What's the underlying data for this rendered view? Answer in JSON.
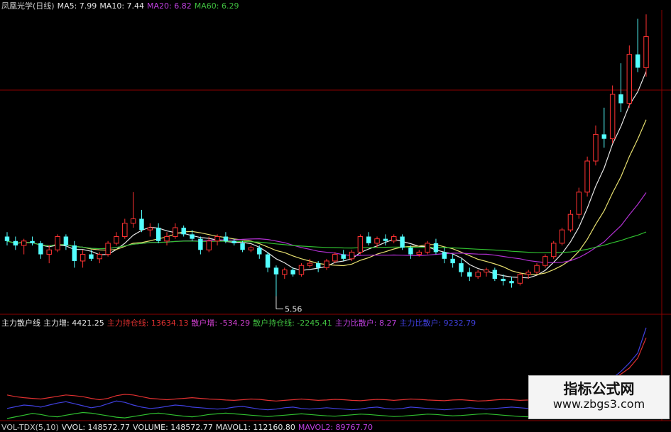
{
  "top_header": {
    "items": [
      {
        "text": "凤凰光学(日线)",
        "color": "#c8c8c8"
      },
      {
        "text": "MA5: 7.99",
        "color": "#e6e6e6"
      },
      {
        "text": "MA10: 7.44",
        "color": "#e6e6e6"
      },
      {
        "text": "MA20: 6.82",
        "color": "#c040e0"
      },
      {
        "text": "MA60: 6.29",
        "color": "#40c040"
      }
    ]
  },
  "indicator_header": {
    "items": [
      {
        "text": "主力散户线",
        "color": "#e6e6e6"
      },
      {
        "text": "主力增: 4421.25",
        "color": "#e6e6e6"
      },
      {
        "text": "主力持仓线: 13634.13",
        "color": "#e03030"
      },
      {
        "text": "散户增: -534.29",
        "color": "#d040d0"
      },
      {
        "text": "散户持仓线: -2245.41",
        "color": "#40c040"
      },
      {
        "text": "主力比散户: 8.27",
        "color": "#c040e0"
      },
      {
        "text": "主力比散户: 9232.79",
        "color": "#4040e0"
      }
    ]
  },
  "volume_header": {
    "items": [
      {
        "text": "VOL-TDX(5,10)",
        "color": "#c8c8c8"
      },
      {
        "text": "VVOL: 148572.77",
        "color": "#e6e6e6"
      },
      {
        "text": "VOLUME: 148572.77",
        "color": "#e6e6e6"
      },
      {
        "text": "MAVOL1: 112160.80",
        "color": "#e6e6e6"
      },
      {
        "text": "MAVOL2: 89767.70",
        "color": "#c040e0"
      }
    ]
  },
  "watermark": {
    "title": "指标公式网",
    "url": "www.zbgs3.com"
  },
  "colors": {
    "up": "#ff3232",
    "down": "#54ffff",
    "ma5": "#e6e6e6",
    "ma10": "#e8e070",
    "ma20": "#b030d0",
    "ma60": "#30c030",
    "grid": "#8b0000"
  },
  "chart_data": [
    {
      "type": "candlestick",
      "title": "凤凰光学(日线)",
      "price_range": [
        5.2,
        12.0
      ],
      "annotation": {
        "label": "5.56",
        "value": 5.56
      },
      "candles": [
        [
          6.9,
          7.0,
          6.7,
          6.8
        ],
        [
          6.8,
          6.9,
          6.6,
          6.7
        ],
        [
          6.7,
          6.85,
          6.5,
          6.8
        ],
        [
          6.8,
          6.9,
          6.7,
          6.75
        ],
        [
          6.75,
          6.8,
          6.4,
          6.5
        ],
        [
          6.5,
          6.7,
          6.3,
          6.6
        ],
        [
          6.6,
          6.95,
          6.55,
          6.9
        ],
        [
          6.9,
          6.95,
          6.6,
          6.7
        ],
        [
          6.7,
          6.8,
          6.2,
          6.35
        ],
        [
          6.35,
          6.6,
          6.2,
          6.5
        ],
        [
          6.5,
          6.6,
          6.35,
          6.4
        ],
        [
          6.4,
          6.55,
          6.3,
          6.5
        ],
        [
          6.5,
          6.8,
          6.45,
          6.75
        ],
        [
          6.75,
          7.0,
          6.7,
          6.9
        ],
        [
          6.9,
          7.3,
          6.85,
          7.2
        ],
        [
          7.2,
          7.9,
          7.1,
          7.3
        ],
        [
          7.3,
          7.5,
          7.0,
          7.05
        ],
        [
          7.05,
          7.2,
          6.9,
          7.1
        ],
        [
          7.1,
          7.2,
          6.75,
          6.8
        ],
        [
          6.8,
          7.0,
          6.7,
          6.9
        ],
        [
          6.9,
          7.2,
          6.85,
          7.1
        ],
        [
          7.1,
          7.15,
          6.9,
          6.95
        ],
        [
          6.95,
          7.05,
          6.8,
          6.85
        ],
        [
          6.85,
          6.9,
          6.5,
          6.6
        ],
        [
          6.6,
          6.9,
          6.55,
          6.8
        ],
        [
          6.8,
          6.95,
          6.7,
          6.9
        ],
        [
          6.9,
          7.0,
          6.75,
          6.8
        ],
        [
          6.8,
          6.85,
          6.7,
          6.75
        ],
        [
          6.75,
          6.8,
          6.55,
          6.6
        ],
        [
          6.6,
          6.7,
          6.55,
          6.65
        ],
        [
          6.65,
          6.7,
          6.4,
          6.5
        ],
        [
          6.5,
          6.55,
          6.1,
          6.2
        ],
        [
          6.2,
          6.25,
          5.56,
          6.05
        ],
        [
          6.05,
          6.2,
          5.95,
          6.15
        ],
        [
          6.15,
          6.2,
          6.0,
          6.05
        ],
        [
          6.05,
          6.3,
          6.0,
          6.25
        ],
        [
          6.25,
          6.4,
          6.2,
          6.3
        ],
        [
          6.3,
          6.35,
          6.1,
          6.2
        ],
        [
          6.2,
          6.4,
          6.15,
          6.35
        ],
        [
          6.35,
          6.55,
          6.3,
          6.5
        ],
        [
          6.5,
          6.6,
          6.35,
          6.4
        ],
        [
          6.4,
          6.6,
          6.35,
          6.55
        ],
        [
          6.55,
          6.95,
          6.5,
          6.9
        ],
        [
          6.9,
          7.0,
          6.7,
          6.75
        ],
        [
          6.75,
          6.9,
          6.65,
          6.85
        ],
        [
          6.85,
          6.95,
          6.7,
          6.8
        ],
        [
          6.8,
          6.95,
          6.75,
          6.9
        ],
        [
          6.9,
          6.95,
          6.6,
          6.65
        ],
        [
          6.65,
          6.7,
          6.4,
          6.5
        ],
        [
          6.5,
          6.6,
          6.45,
          6.55
        ],
        [
          6.55,
          6.8,
          6.5,
          6.75
        ],
        [
          6.75,
          6.85,
          6.5,
          6.55
        ],
        [
          6.55,
          6.65,
          6.3,
          6.4
        ],
        [
          6.4,
          6.5,
          6.2,
          6.3
        ],
        [
          6.3,
          6.4,
          6.0,
          6.1
        ],
        [
          6.1,
          6.2,
          5.9,
          6.0
        ],
        [
          6.0,
          6.15,
          5.95,
          6.1
        ],
        [
          6.1,
          6.2,
          6.0,
          6.15
        ],
        [
          6.15,
          6.2,
          5.9,
          5.95
        ],
        [
          5.95,
          6.05,
          5.8,
          5.9
        ],
        [
          5.9,
          6.0,
          5.75,
          5.85
        ],
        [
          5.85,
          6.1,
          5.8,
          6.05
        ],
        [
          6.05,
          6.15,
          5.95,
          6.1
        ],
        [
          6.1,
          6.3,
          6.05,
          6.25
        ],
        [
          6.25,
          6.5,
          6.2,
          6.45
        ],
        [
          6.45,
          6.8,
          6.4,
          6.75
        ],
        [
          6.75,
          7.1,
          6.7,
          7.05
        ],
        [
          7.05,
          7.5,
          7.0,
          7.4
        ],
        [
          7.4,
          8.0,
          7.3,
          7.9
        ],
        [
          7.9,
          8.7,
          7.8,
          8.6
        ],
        [
          8.6,
          9.4,
          8.5,
          9.2
        ],
        [
          9.2,
          9.8,
          8.9,
          9.1
        ],
        [
          9.1,
          10.3,
          9.0,
          10.1
        ],
        [
          10.1,
          10.8,
          9.7,
          9.9
        ],
        [
          9.9,
          11.2,
          9.8,
          11.0
        ],
        [
          11.0,
          11.8,
          10.6,
          10.7
        ],
        [
          10.7,
          11.9,
          10.5,
          11.4
        ]
      ],
      "ma_periods": [
        5,
        10,
        20,
        60
      ]
    },
    {
      "type": "line",
      "title": "主力散户线",
      "series": [
        {
          "name": "主力持仓线",
          "color": "#e03030",
          "values": [
            0.6,
            0.55,
            0.52,
            0.5,
            0.48,
            0.52,
            0.56,
            0.6,
            0.58,
            0.55,
            0.5,
            0.46,
            0.5,
            0.58,
            0.62,
            0.6,
            0.55,
            0.5,
            0.48,
            0.46,
            0.48,
            0.5,
            0.52,
            0.5,
            0.48,
            0.47,
            0.45,
            0.44,
            0.46,
            0.48,
            0.47,
            0.44,
            0.42,
            0.44,
            0.46,
            0.48,
            0.46,
            0.44,
            0.45,
            0.47,
            0.46,
            0.44,
            0.43,
            0.45,
            0.47,
            0.46,
            0.44,
            0.46,
            0.48,
            0.47,
            0.45,
            0.44,
            0.43,
            0.45,
            0.46,
            0.44,
            0.42,
            0.43,
            0.45,
            0.47,
            0.46,
            0.44,
            0.45,
            0.47,
            0.48,
            0.5,
            0.52,
            0.55,
            0.6,
            0.68,
            0.8,
            0.92,
            1.05,
            1.22,
            1.4,
            1.7,
            2.3
          ]
        },
        {
          "name": "散户持仓线",
          "color": "#30c030",
          "values": [
            -0.1,
            -0.05,
            0.0,
            0.05,
            0.02,
            -0.03,
            -0.05,
            0.0,
            0.04,
            0.08,
            0.06,
            0.02,
            -0.02,
            -0.06,
            -0.08,
            -0.04,
            0.0,
            0.04,
            0.06,
            0.03,
            0.0,
            -0.03,
            -0.05,
            -0.02,
            0.02,
            0.04,
            0.06,
            0.04,
            0.02,
            0.0,
            -0.02,
            -0.04,
            -0.02,
            0.0,
            0.02,
            0.04,
            0.02,
            0.0,
            -0.02,
            -0.03,
            -0.01,
            0.01,
            0.03,
            0.02,
            0.0,
            -0.02,
            -0.04,
            -0.03,
            -0.01,
            0.01,
            0.03,
            0.02,
            0.0,
            -0.02,
            -0.01,
            0.01,
            0.03,
            0.04,
            0.02,
            0.0,
            -0.02,
            -0.04,
            -0.05,
            -0.03,
            -0.01,
            0.01,
            0.0,
            -0.02,
            -0.04,
            -0.06,
            -0.05,
            -0.03,
            -0.01,
            0.0,
            -0.02,
            -0.04,
            -0.05
          ]
        },
        {
          "name": "主力比散户",
          "color": "#4040e0",
          "values": [
            0.2,
            0.25,
            0.3,
            0.28,
            0.24,
            0.3,
            0.36,
            0.4,
            0.34,
            0.28,
            0.22,
            0.26,
            0.34,
            0.42,
            0.38,
            0.3,
            0.24,
            0.2,
            0.22,
            0.26,
            0.3,
            0.28,
            0.24,
            0.22,
            0.2,
            0.18,
            0.2,
            0.24,
            0.26,
            0.22,
            0.18,
            0.16,
            0.18,
            0.22,
            0.24,
            0.2,
            0.18,
            0.2,
            0.22,
            0.2,
            0.18,
            0.16,
            0.18,
            0.22,
            0.24,
            0.2,
            0.18,
            0.2,
            0.24,
            0.22,
            0.2,
            0.18,
            0.16,
            0.18,
            0.2,
            0.22,
            0.2,
            0.18,
            0.2,
            0.22,
            0.24,
            0.22,
            0.2,
            0.22,
            0.26,
            0.3,
            0.34,
            0.4,
            0.48,
            0.6,
            0.75,
            0.92,
            1.1,
            1.3,
            1.55,
            1.85,
            2.6
          ]
        }
      ]
    }
  ]
}
